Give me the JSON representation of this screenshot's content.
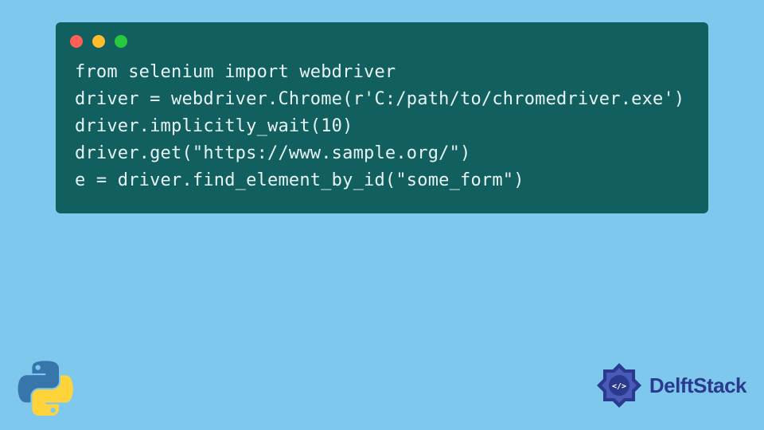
{
  "code": {
    "lines": [
      "from selenium import webdriver",
      "driver = webdriver.Chrome(r'C:/path/to/chromedriver.exe')",
      "driver.implicitly_wait(10)",
      "driver.get(\"https://www.sample.org/\")",
      "e = driver.find_element_by_id(\"some_form\")"
    ]
  },
  "colors": {
    "background": "#7ec8ed",
    "window_bg": "#125f5f",
    "code_text": "#e8f4f4",
    "dot_red": "#ff5f56",
    "dot_yellow": "#ffbd2e",
    "dot_green": "#27c93f",
    "brand_blue": "#2b3a8f"
  },
  "brand": {
    "name": "DelftStack"
  }
}
